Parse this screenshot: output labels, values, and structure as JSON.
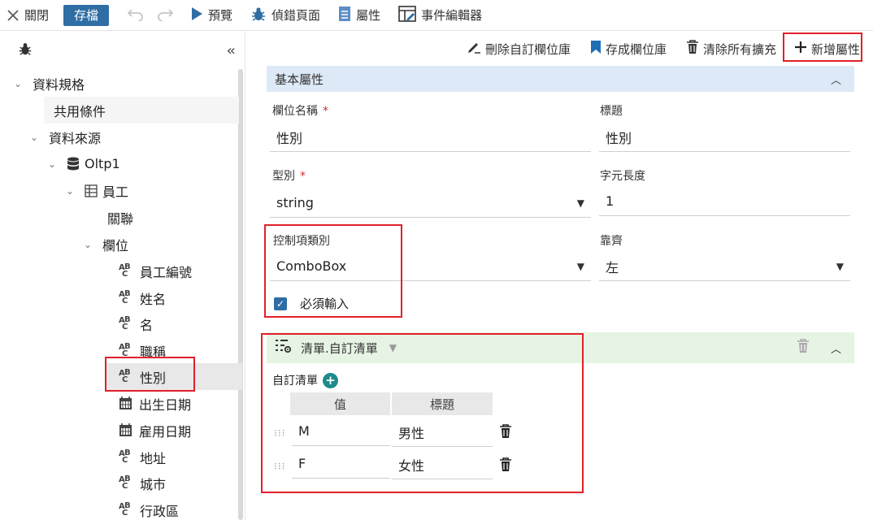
{
  "toolbar": {
    "close": "關閉",
    "save": "存檔",
    "preview": "預覽",
    "debug": "偵錯頁面",
    "properties": "屬性",
    "event_editor": "事件編輯器"
  },
  "sidebar": {
    "tree": [
      {
        "label": "資料規格"
      },
      {
        "label": "共用條件"
      },
      {
        "label": "資料來源"
      },
      {
        "label": "Oltp1"
      },
      {
        "label": "員工"
      },
      {
        "label": "關聯"
      },
      {
        "label": "欄位"
      },
      {
        "label": "員工編號"
      },
      {
        "label": "姓名"
      },
      {
        "label": "名"
      },
      {
        "label": "職稱"
      },
      {
        "label": "性別"
      },
      {
        "label": "出生日期"
      },
      {
        "label": "雇用日期"
      },
      {
        "label": "地址"
      },
      {
        "label": "城市"
      },
      {
        "label": "行政區"
      }
    ]
  },
  "actions": {
    "delete_custom": "刪除自訂欄位庫",
    "save_as": "存成欄位庫",
    "clear_all": "清除所有擴充",
    "add_property": "新增屬性"
  },
  "basic": {
    "header": "基本屬性",
    "field_name_label": "欄位名稱",
    "field_name_value": "性別",
    "title_label": "標題",
    "title_value": "性別",
    "type_label": "型別",
    "type_value": "string",
    "length_label": "字元長度",
    "length_value": "1",
    "control_label": "控制項類別",
    "control_value": "ComboBox",
    "align_label": "靠齊",
    "align_value": "左",
    "required_label": "必須輸入",
    "required_checked": true
  },
  "list": {
    "header": "清單.自訂清單",
    "custom_label": "自訂清單",
    "columns": [
      "值",
      "標題"
    ],
    "rows": [
      {
        "value": "M",
        "title": "男性"
      },
      {
        "value": "F",
        "title": "女性"
      }
    ]
  }
}
